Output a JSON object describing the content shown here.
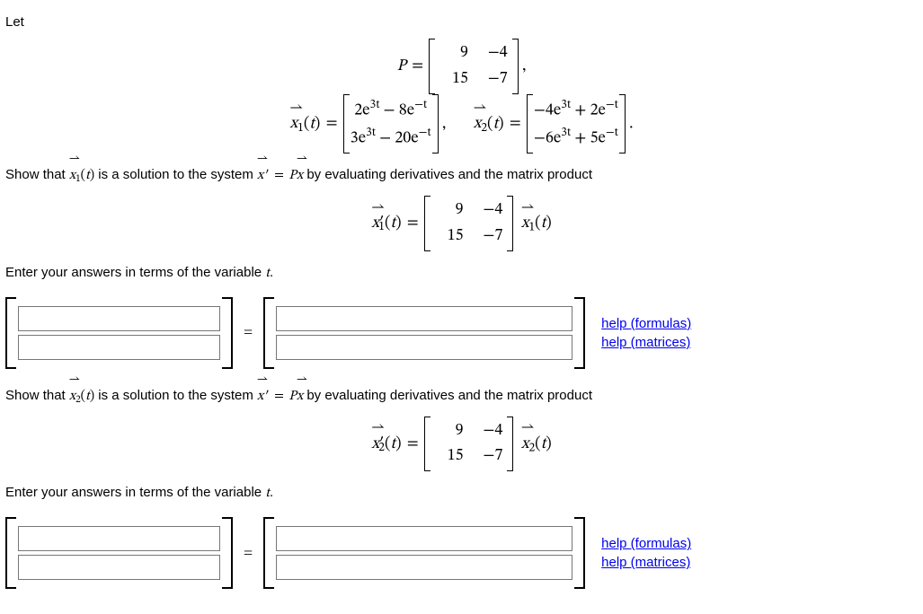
{
  "intro": "Let",
  "P_label": "P",
  "matrixP": {
    "r1c1": "9",
    "r1c2": "−4",
    "r2c1": "15",
    "r2c2": "−7"
  },
  "x1_def": {
    "row1": "2e",
    "row1_exp": "3t",
    "row1_tail": " − 8e",
    "row1_exp2": "−t",
    "row2": "3e",
    "row2_exp": "3t",
    "row2_tail": " − 20e",
    "row2_exp2": "−t"
  },
  "x2_def": {
    "row1": "−4e",
    "row1_exp": "3t",
    "row1_tail": " + 2e",
    "row1_exp2": "−t",
    "row2": "−6e",
    "row2_exp": "3t",
    "row2_tail": " + 5e",
    "row2_exp2": "−t"
  },
  "show1": {
    "pre": "Show that ",
    "mid": " is a solution to the system ",
    "post": " by evaluating derivatives and the matrix product"
  },
  "show2": {
    "pre": "Show that ",
    "mid": " is a solution to the system ",
    "post": " by evaluating derivatives and the matrix product"
  },
  "enter_hint": "Enter your answers in terms of the variable ",
  "var_t": "t",
  "period": ".",
  "help": {
    "formulas": "help (formulas)",
    "matrices": "help (matrices)"
  },
  "sym": {
    "eq": "=",
    "comma": ",",
    "dot": "."
  }
}
